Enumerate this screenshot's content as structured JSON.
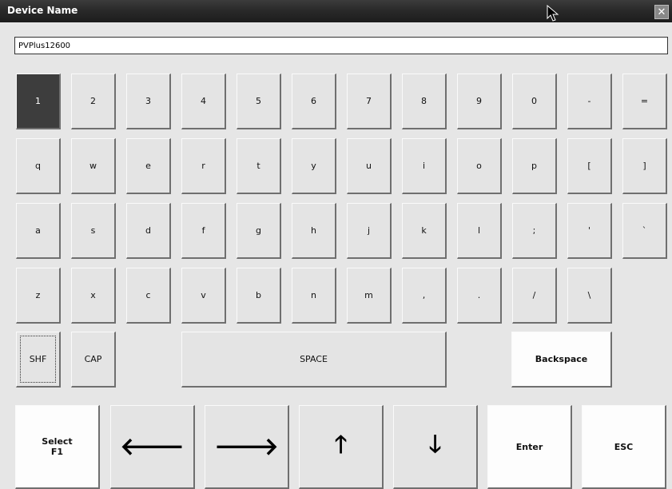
{
  "window": {
    "title": "Device Name",
    "close_symbol": "✕"
  },
  "name_field": {
    "value": "PVPlus12600"
  },
  "keyboard": {
    "rows": [
      [
        "1",
        "2",
        "3",
        "4",
        "5",
        "6",
        "7",
        "8",
        "9",
        "0",
        "-",
        "="
      ],
      [
        "q",
        "w",
        "e",
        "r",
        "t",
        "y",
        "u",
        "i",
        "o",
        "p",
        "[",
        "]"
      ],
      [
        "a",
        "s",
        "d",
        "f",
        "g",
        "h",
        "j",
        "k",
        "l",
        ";",
        "'",
        "`"
      ],
      [
        "z",
        "x",
        "c",
        "v",
        "b",
        "n",
        "m",
        ",",
        ".",
        "/",
        "\\"
      ]
    ],
    "shift_label": "SHF",
    "caps_label": "CAP",
    "space_label": "SPACE",
    "backspace_label": "Backspace",
    "active_key": "1"
  },
  "bottom_bar": {
    "select_label_line1": "Select",
    "select_label_line2": "F1",
    "left_arrow": "🡐",
    "right_arrow": "🡒",
    "up_arrow": "🡑",
    "down_arrow": "🡓",
    "enter_label": "Enter",
    "esc_label": "ESC"
  }
}
